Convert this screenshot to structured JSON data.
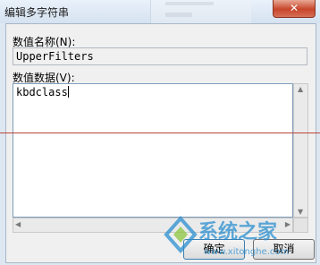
{
  "window": {
    "title": "编辑多字符串",
    "close_glyph": "✕"
  },
  "value_name": {
    "label": "数值名称(N):",
    "value": "UpperFilters"
  },
  "value_data": {
    "label": "数值数据(V):",
    "value": "kbdclass"
  },
  "buttons": {
    "ok": "确定",
    "cancel": "取消"
  },
  "watermark": {
    "brand": "系统之家",
    "url": "www.xitonghe.com"
  },
  "colors": {
    "title_gradient_top": "#e9f1fa",
    "close_button": "#c7452a",
    "red_line": "#b9473a",
    "watermark_blue": "#2a8fd0"
  }
}
